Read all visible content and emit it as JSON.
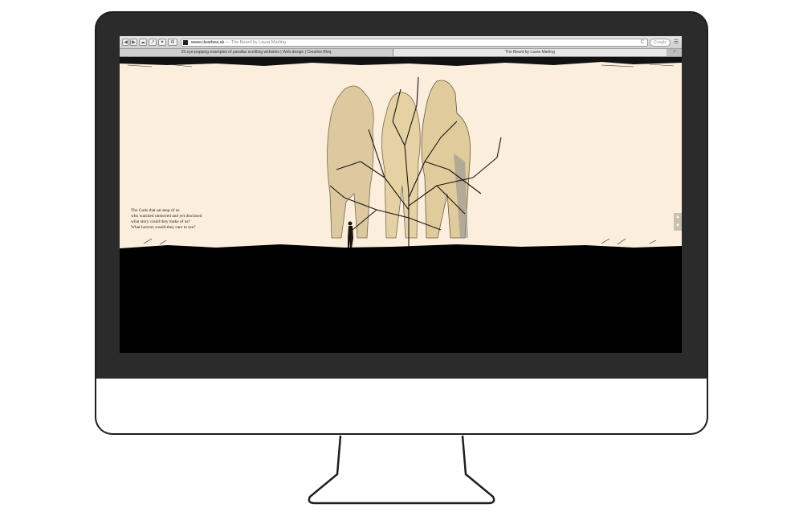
{
  "browser": {
    "nav_back": "◀",
    "nav_forward": "▶",
    "url": "www.clearbea.sk",
    "page_title": "The Beard by Laura Marling",
    "reload": "C",
    "search_placeholder": "Google",
    "menu": "☰"
  },
  "tabs": [
    {
      "label": "25 eye-popping examples of parallax scrolling websites | Web design | Creative Bloq"
    },
    {
      "label": "The Beard by Laura Marling"
    }
  ],
  "tab_new": "+",
  "poem": [
    "The Gods that sat atop of us",
    "who watched unmoved and yet disclosed",
    "what story could they make of us?",
    "What horrors would they care to see?"
  ],
  "scroll": {
    "up": "▲",
    "down": "▼"
  },
  "colors": {
    "scene_bg": "#fbeedc",
    "ground": "#000000",
    "bezel": "#2b2b2b"
  }
}
